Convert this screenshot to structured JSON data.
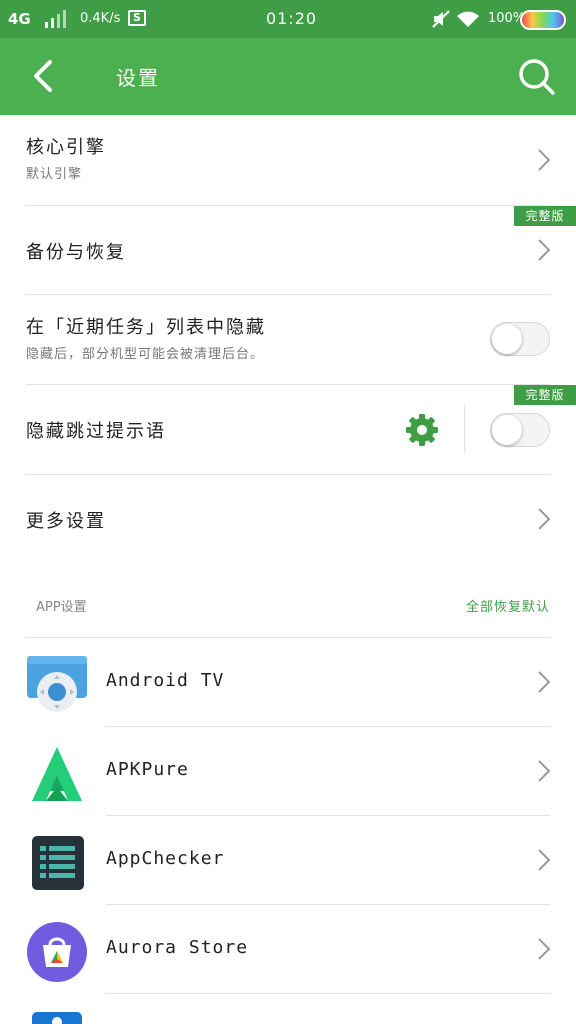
{
  "status_bar": {
    "network": "4G",
    "speed": "0.4K/s",
    "sim_icon_text": "S",
    "time": "01:20",
    "battery": "100%",
    "icons": [
      "signal-bars-icon",
      "mute-icon",
      "wifi-icon",
      "battery-icon"
    ]
  },
  "header": {
    "title": "设置",
    "back_icon": "back-arrow-icon",
    "search_icon": "search-icon",
    "bg_color": "#4caf50"
  },
  "settings": {
    "core_engine": {
      "title": "核心引擎",
      "subtitle": "默认引擎"
    },
    "backup_restore": {
      "title": "备份与恢复",
      "badge": "完整版"
    },
    "hide_recent": {
      "title": "在「近期任务」列表中隐藏",
      "subtitle": "隐藏后，部分机型可能会被清理后台。",
      "enabled": false
    },
    "hide_skip": {
      "title": "隐藏跳过提示语",
      "badge": "完整版",
      "enabled": false
    },
    "more": {
      "title": "更多设置"
    }
  },
  "app_section": {
    "header": "APP设置",
    "reset_all": "全部恢复默认",
    "apps": [
      {
        "name": "Android TV",
        "icon": "android-tv-icon"
      },
      {
        "name": "APKPure",
        "icon": "apkpure-icon"
      },
      {
        "name": "AppChecker",
        "icon": "appchecker-icon"
      },
      {
        "name": "Aurora Store",
        "icon": "aurora-store-icon"
      }
    ]
  },
  "accent_color": "#3f9e45"
}
